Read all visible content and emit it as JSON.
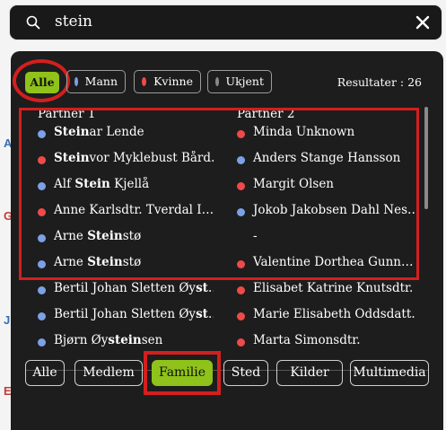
{
  "search": {
    "query": "stein"
  },
  "filters": {
    "all_label": "Alle",
    "gender": [
      {
        "label": "Mann",
        "color": "#7ba1e6"
      },
      {
        "label": "Kvinne",
        "color": "#ef4a4a"
      },
      {
        "label": "Ukjent",
        "color": "#888888"
      }
    ],
    "results_text": "Resultater : 26"
  },
  "columns": {
    "partner1": "Partner 1",
    "partner2": "Partner 2"
  },
  "rows": [
    {
      "p1": {
        "pre": "",
        "match": "Stein",
        "post": "ar Lende",
        "gender": "male"
      },
      "p2": {
        "name": "Minda Unknown",
        "gender": "female"
      }
    },
    {
      "p1": {
        "pre": "",
        "match": "Stein",
        "post": "vor Myklebust Bård…",
        "gender": "female"
      },
      "p2": {
        "name": "Anders Stange Hansson",
        "gender": "male"
      }
    },
    {
      "p1": {
        "pre": "Alf ",
        "match": "Stein",
        "post": " Kjellå",
        "gender": "male"
      },
      "p2": {
        "name": "Margit Olsen",
        "gender": "female"
      }
    },
    {
      "p1": {
        "pre": "Anne Karlsdtr. Tverdal I…",
        "match": "",
        "post": "",
        "gender": "female"
      },
      "p2": {
        "name": "Jokob Jakobsen Dahl Nes…",
        "gender": "male"
      }
    },
    {
      "p1": {
        "pre": "Arne ",
        "match": "Stein",
        "post": "stø",
        "gender": "male"
      },
      "p2": {
        "name": "-",
        "gender": "none"
      }
    },
    {
      "p1": {
        "pre": "Arne ",
        "match": "Stein",
        "post": "stø",
        "gender": "male"
      },
      "p2": {
        "name": "Valentine Dorthea Gunn…",
        "gender": "female"
      }
    },
    {
      "p1": {
        "pre": "Bertil Johan Sletten Øy",
        "match": "st",
        "post": "…",
        "gender": "male"
      },
      "p2": {
        "name": "Elisabet Katrine Knutsdtr.",
        "gender": "female"
      }
    },
    {
      "p1": {
        "pre": "Bertil Johan Sletten Øy",
        "match": "st",
        "post": "…",
        "gender": "male"
      },
      "p2": {
        "name": "Marie Elisabeth Oddsdatt…",
        "gender": "female"
      }
    },
    {
      "p1": {
        "pre": "Bjørn Øy",
        "match": "stein",
        "post": "sen",
        "gender": "male"
      },
      "p2": {
        "name": "Marta Simonsdtr.",
        "gender": "female"
      }
    }
  ],
  "tabs": [
    "Alle",
    "Medlem",
    "Familie",
    "Sted",
    "Kilder",
    "Multimedia"
  ],
  "active_tab": "Familie",
  "colors": {
    "accent": "#8fc21a",
    "highlight": "#d31f1f",
    "male": "#7ba1e6",
    "female": "#ef4a4a",
    "panel": "#1d1d1d"
  },
  "background_fragments": [
    "A",
    "G",
    "J",
    "E"
  ]
}
